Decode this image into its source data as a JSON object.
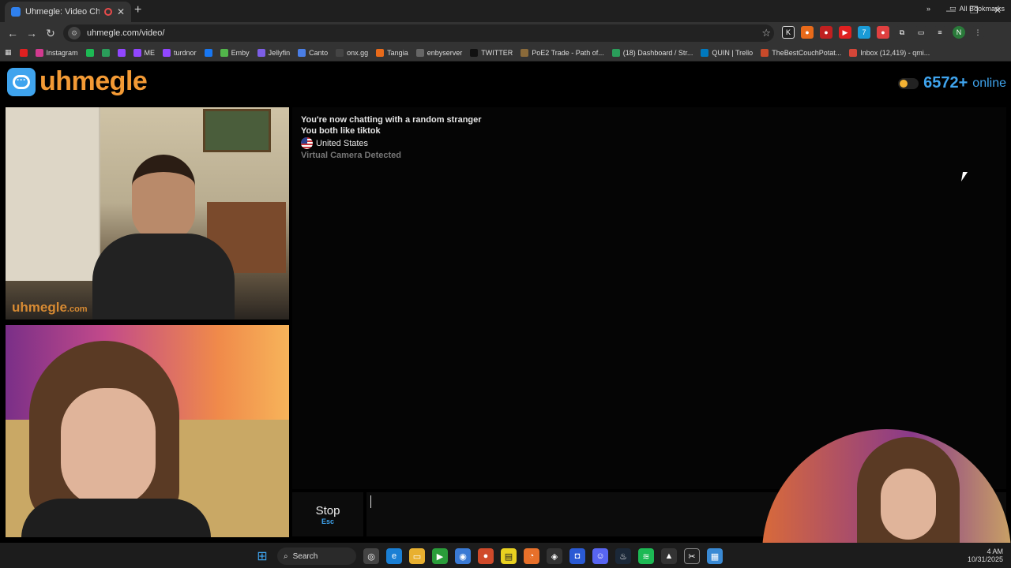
{
  "browser": {
    "tab_title": "Uhmegle: Video Chat | Ran",
    "url": "uhmegle.com/video/",
    "bookmarks": [
      {
        "label": "",
        "color": "#e02020"
      },
      {
        "label": "Instagram",
        "color": "#d13a8f"
      },
      {
        "label": "",
        "color": "#1db954"
      },
      {
        "label": "",
        "color": "#2a9d5a"
      },
      {
        "label": "",
        "color": "#9146ff"
      },
      {
        "label": "ME",
        "color": "#9146ff"
      },
      {
        "label": "turdnor",
        "color": "#9146ff"
      },
      {
        "label": "",
        "color": "#1877f2"
      },
      {
        "label": "Emby",
        "color": "#52b54b"
      },
      {
        "label": "Jellyfin",
        "color": "#7c5ee6"
      },
      {
        "label": "Canto",
        "color": "#4a7ee6"
      },
      {
        "label": "onx.gg",
        "color": "#444"
      },
      {
        "label": "Tangia",
        "color": "#e86a1a"
      },
      {
        "label": "enbyserver",
        "color": "#666"
      },
      {
        "label": "TWITTER",
        "color": "#111"
      },
      {
        "label": "PoE2 Trade - Path of...",
        "color": "#8a6a3a"
      },
      {
        "label": "(18) Dashboard / Str...",
        "color": "#2a9d5a"
      },
      {
        "label": "QUIN | Trello",
        "color": "#0079bf"
      },
      {
        "label": "TheBestCouchPotat...",
        "color": "#c84a2a"
      },
      {
        "label": "Inbox (12,419) - qmi...",
        "color": "#d44638"
      }
    ],
    "all_bookmarks": "All Bookmarks"
  },
  "header": {
    "logo": "uhmegle",
    "online_count": "6572+",
    "online_label": "online"
  },
  "video": {
    "watermark": "uhmegle",
    "watermark_suffix": ".com"
  },
  "chat": {
    "line1": "You're now chatting with a random stranger",
    "line2": "You both like tiktok",
    "country": "United States",
    "warning": "Virtual Camera Detected"
  },
  "controls": {
    "stop_label": "Stop",
    "stop_shortcut": "Esc"
  },
  "taskbar": {
    "search_label": "Search",
    "time": "4 AM",
    "date": "10/31/2025"
  },
  "colors": {
    "accent_blue": "#3fa4ee",
    "accent_orange": "#f39a35"
  }
}
